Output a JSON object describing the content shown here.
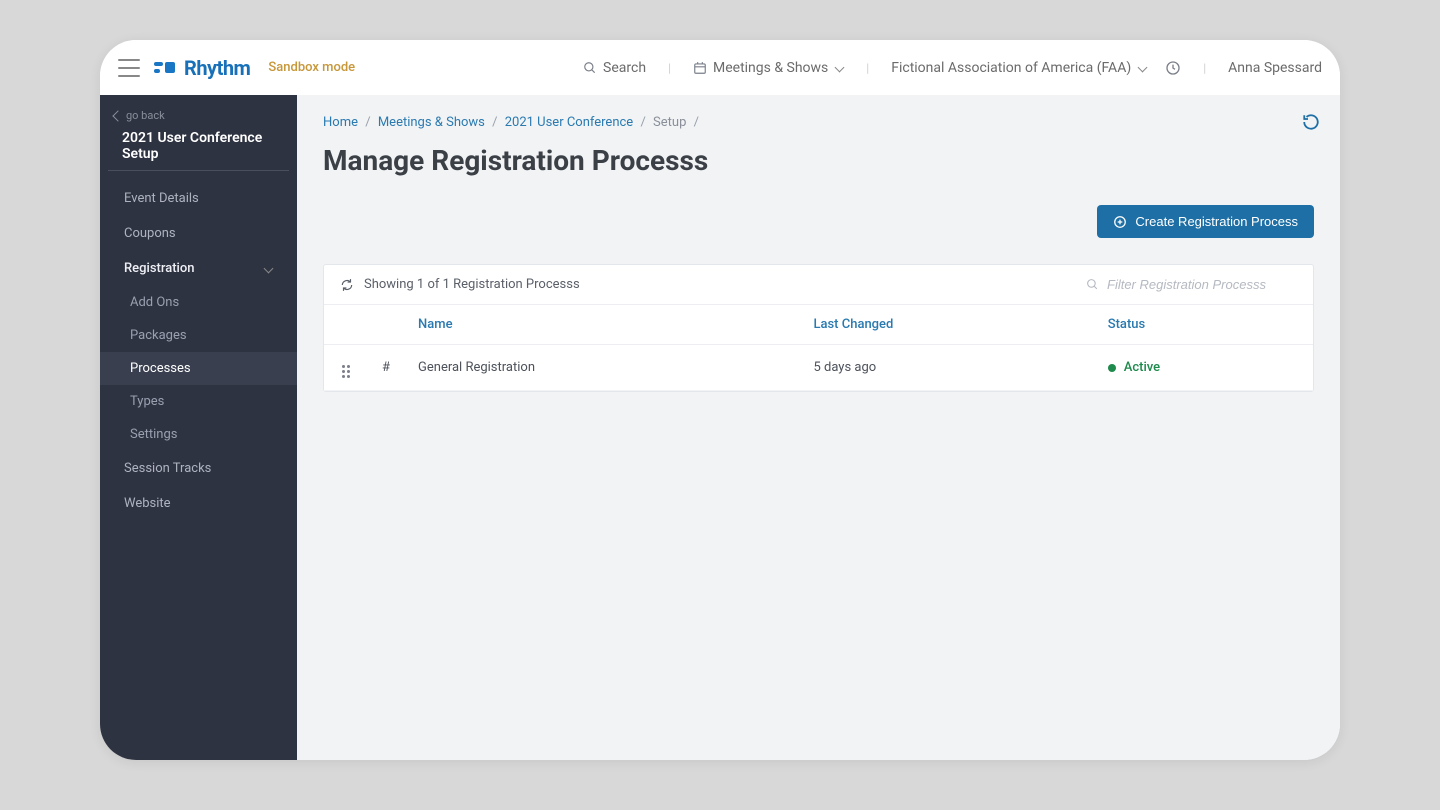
{
  "header": {
    "brand": "Rhythm",
    "sandbox_label": "Sandbox mode",
    "search_label": "Search",
    "nav_dropdown_label": "Meetings & Shows",
    "org_label": "Fictional Association of America (FAA)",
    "user_name": "Anna Spessard"
  },
  "sidebar": {
    "go_back_label": "go back",
    "title": "2021 User Conference Setup",
    "items": [
      {
        "label": "Event Details"
      },
      {
        "label": "Coupons"
      },
      {
        "label": "Registration",
        "expanded": true
      },
      {
        "label": "Session Tracks"
      },
      {
        "label": "Website"
      }
    ],
    "registration_children": [
      {
        "label": "Add Ons"
      },
      {
        "label": "Packages"
      },
      {
        "label": "Processes",
        "active": true
      },
      {
        "label": "Types"
      },
      {
        "label": "Settings"
      }
    ]
  },
  "breadcrumb": {
    "home": "Home",
    "meetings": "Meetings & Shows",
    "event": "2021 User Conference",
    "setup": "Setup"
  },
  "page": {
    "title": "Manage Registration Processs",
    "create_button": "Create Registration Process",
    "showing_text": "Showing 1 of 1 Registration Processs",
    "filter_placeholder": "Filter Registration Processs",
    "columns": {
      "name": "Name",
      "last_changed": "Last Changed",
      "status": "Status"
    },
    "rows": [
      {
        "num": "#",
        "name": "General Registration",
        "last_changed": "5 days ago",
        "status": "Active"
      }
    ]
  },
  "colors": {
    "brand_blue": "#1770b8",
    "primary_button": "#1d6fa5",
    "sidebar_bg": "#2e3341",
    "status_active": "#1e8a4c"
  }
}
